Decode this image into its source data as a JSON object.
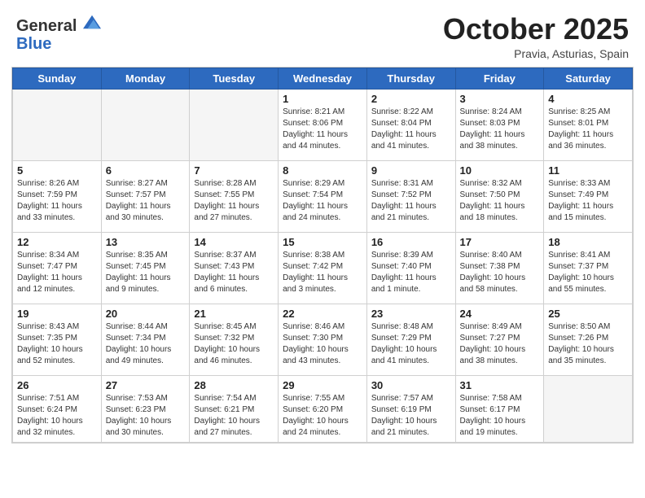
{
  "header": {
    "logo_line1": "General",
    "logo_line2": "Blue",
    "month_title": "October 2025",
    "location": "Pravia, Asturias, Spain"
  },
  "days_of_week": [
    "Sunday",
    "Monday",
    "Tuesday",
    "Wednesday",
    "Thursday",
    "Friday",
    "Saturday"
  ],
  "weeks": [
    [
      {
        "day": "",
        "text": ""
      },
      {
        "day": "",
        "text": ""
      },
      {
        "day": "",
        "text": ""
      },
      {
        "day": "1",
        "text": "Sunrise: 8:21 AM\nSunset: 8:06 PM\nDaylight: 11 hours\nand 44 minutes."
      },
      {
        "day": "2",
        "text": "Sunrise: 8:22 AM\nSunset: 8:04 PM\nDaylight: 11 hours\nand 41 minutes."
      },
      {
        "day": "3",
        "text": "Sunrise: 8:24 AM\nSunset: 8:03 PM\nDaylight: 11 hours\nand 38 minutes."
      },
      {
        "day": "4",
        "text": "Sunrise: 8:25 AM\nSunset: 8:01 PM\nDaylight: 11 hours\nand 36 minutes."
      }
    ],
    [
      {
        "day": "5",
        "text": "Sunrise: 8:26 AM\nSunset: 7:59 PM\nDaylight: 11 hours\nand 33 minutes."
      },
      {
        "day": "6",
        "text": "Sunrise: 8:27 AM\nSunset: 7:57 PM\nDaylight: 11 hours\nand 30 minutes."
      },
      {
        "day": "7",
        "text": "Sunrise: 8:28 AM\nSunset: 7:55 PM\nDaylight: 11 hours\nand 27 minutes."
      },
      {
        "day": "8",
        "text": "Sunrise: 8:29 AM\nSunset: 7:54 PM\nDaylight: 11 hours\nand 24 minutes."
      },
      {
        "day": "9",
        "text": "Sunrise: 8:31 AM\nSunset: 7:52 PM\nDaylight: 11 hours\nand 21 minutes."
      },
      {
        "day": "10",
        "text": "Sunrise: 8:32 AM\nSunset: 7:50 PM\nDaylight: 11 hours\nand 18 minutes."
      },
      {
        "day": "11",
        "text": "Sunrise: 8:33 AM\nSunset: 7:49 PM\nDaylight: 11 hours\nand 15 minutes."
      }
    ],
    [
      {
        "day": "12",
        "text": "Sunrise: 8:34 AM\nSunset: 7:47 PM\nDaylight: 11 hours\nand 12 minutes."
      },
      {
        "day": "13",
        "text": "Sunrise: 8:35 AM\nSunset: 7:45 PM\nDaylight: 11 hours\nand 9 minutes."
      },
      {
        "day": "14",
        "text": "Sunrise: 8:37 AM\nSunset: 7:43 PM\nDaylight: 11 hours\nand 6 minutes."
      },
      {
        "day": "15",
        "text": "Sunrise: 8:38 AM\nSunset: 7:42 PM\nDaylight: 11 hours\nand 3 minutes."
      },
      {
        "day": "16",
        "text": "Sunrise: 8:39 AM\nSunset: 7:40 PM\nDaylight: 11 hours\nand 1 minute."
      },
      {
        "day": "17",
        "text": "Sunrise: 8:40 AM\nSunset: 7:38 PM\nDaylight: 10 hours\nand 58 minutes."
      },
      {
        "day": "18",
        "text": "Sunrise: 8:41 AM\nSunset: 7:37 PM\nDaylight: 10 hours\nand 55 minutes."
      }
    ],
    [
      {
        "day": "19",
        "text": "Sunrise: 8:43 AM\nSunset: 7:35 PM\nDaylight: 10 hours\nand 52 minutes."
      },
      {
        "day": "20",
        "text": "Sunrise: 8:44 AM\nSunset: 7:34 PM\nDaylight: 10 hours\nand 49 minutes."
      },
      {
        "day": "21",
        "text": "Sunrise: 8:45 AM\nSunset: 7:32 PM\nDaylight: 10 hours\nand 46 minutes."
      },
      {
        "day": "22",
        "text": "Sunrise: 8:46 AM\nSunset: 7:30 PM\nDaylight: 10 hours\nand 43 minutes."
      },
      {
        "day": "23",
        "text": "Sunrise: 8:48 AM\nSunset: 7:29 PM\nDaylight: 10 hours\nand 41 minutes."
      },
      {
        "day": "24",
        "text": "Sunrise: 8:49 AM\nSunset: 7:27 PM\nDaylight: 10 hours\nand 38 minutes."
      },
      {
        "day": "25",
        "text": "Sunrise: 8:50 AM\nSunset: 7:26 PM\nDaylight: 10 hours\nand 35 minutes."
      }
    ],
    [
      {
        "day": "26",
        "text": "Sunrise: 7:51 AM\nSunset: 6:24 PM\nDaylight: 10 hours\nand 32 minutes."
      },
      {
        "day": "27",
        "text": "Sunrise: 7:53 AM\nSunset: 6:23 PM\nDaylight: 10 hours\nand 30 minutes."
      },
      {
        "day": "28",
        "text": "Sunrise: 7:54 AM\nSunset: 6:21 PM\nDaylight: 10 hours\nand 27 minutes."
      },
      {
        "day": "29",
        "text": "Sunrise: 7:55 AM\nSunset: 6:20 PM\nDaylight: 10 hours\nand 24 minutes."
      },
      {
        "day": "30",
        "text": "Sunrise: 7:57 AM\nSunset: 6:19 PM\nDaylight: 10 hours\nand 21 minutes."
      },
      {
        "day": "31",
        "text": "Sunrise: 7:58 AM\nSunset: 6:17 PM\nDaylight: 10 hours\nand 19 minutes."
      },
      {
        "day": "",
        "text": ""
      }
    ]
  ]
}
